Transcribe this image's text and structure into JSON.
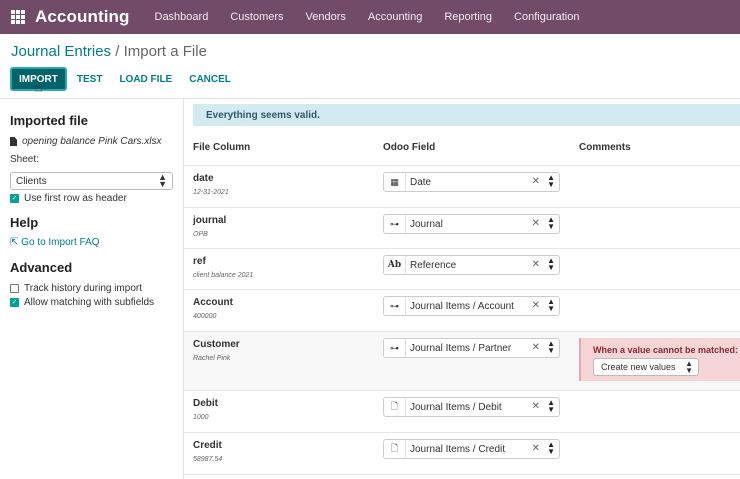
{
  "topnav": {
    "app_name": "Accounting",
    "menu": [
      "Dashboard",
      "Customers",
      "Vendors",
      "Accounting",
      "Reporting",
      "Configuration"
    ],
    "apps_icon": "grid-icon",
    "bg_color": "#714b67"
  },
  "breadcrumb": {
    "parent": "Journal Entries",
    "separator": " / ",
    "current": "Import a File"
  },
  "toolbar": {
    "import_label": "IMPORT",
    "test_label": "TEST",
    "load_file_label": "LOAD FILE",
    "cancel_label": "CANCEL"
  },
  "sidebar": {
    "imported_file_heading": "Imported file",
    "file_name": "opening balance Pink Cars.xlsx",
    "sheet_label": "Sheet:",
    "sheet_value": "Clients",
    "first_row_header_label": "Use first row as header",
    "first_row_header_checked": true,
    "help_heading": "Help",
    "faq_link": "Go to Import FAQ",
    "advanced_heading": "Advanced",
    "track_history_label": "Track history during import",
    "track_history_checked": false,
    "allow_matching_label": "Allow matching with subfields",
    "allow_matching_checked": true
  },
  "alert": {
    "text": "Everything seems valid."
  },
  "table": {
    "headers": {
      "file_column": "File Column",
      "odoo_field": "Odoo Field",
      "comments": "Comments"
    },
    "rows": [
      {
        "column": "date",
        "sample": "12-31-2021",
        "field": "Date",
        "icon": "calendar-icon"
      },
      {
        "column": "journal",
        "sample": "OPB",
        "field": "Journal",
        "icon": "relation-icon"
      },
      {
        "column": "ref",
        "sample": "client balance 2021",
        "field": "Reference",
        "icon": "text-icon"
      },
      {
        "column": "Account",
        "sample": "400000",
        "field": "Journal Items / Account",
        "icon": "relation-icon"
      },
      {
        "column": "Customer",
        "sample": "Rachel Pink",
        "field": "Journal Items / Partner",
        "icon": "relation-icon"
      },
      {
        "column": "Debit",
        "sample": "1000",
        "field": "Journal Items / Debit",
        "icon": "document-icon"
      },
      {
        "column": "Credit",
        "sample": "58987.54",
        "field": "Journal Items / Credit",
        "icon": "document-icon"
      }
    ],
    "unmatched": {
      "label": "When a value cannot be matched:",
      "option": "Create new values"
    }
  }
}
